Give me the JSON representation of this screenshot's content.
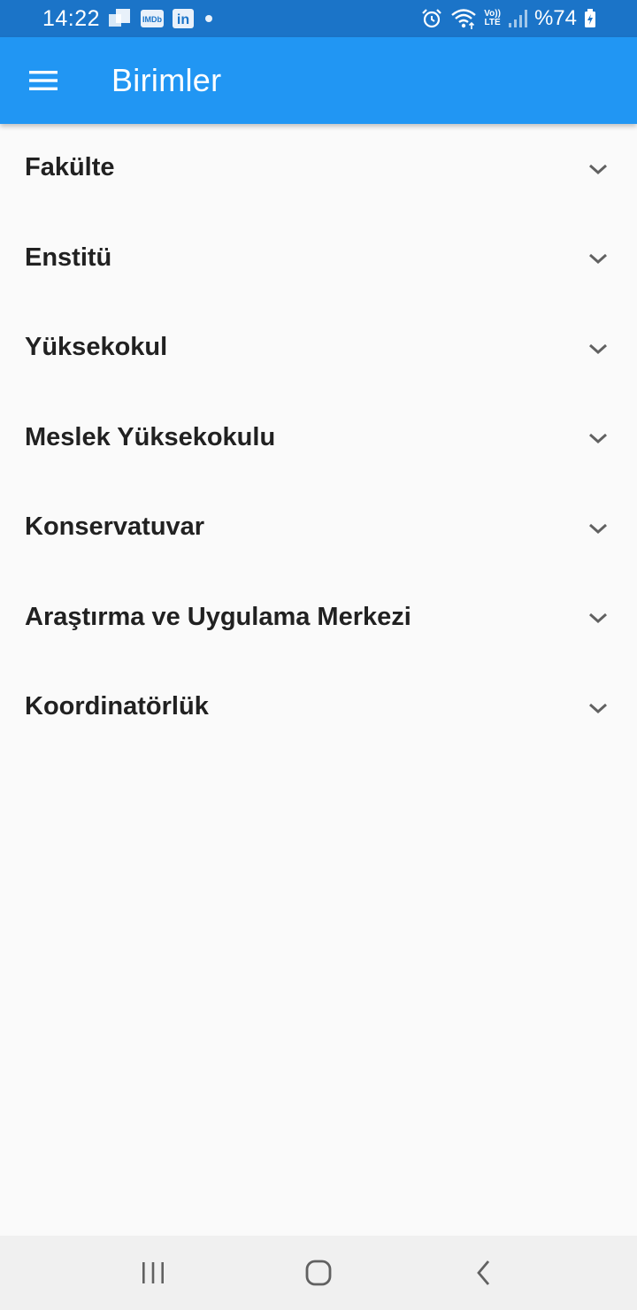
{
  "status_bar": {
    "time": "14:22",
    "notifications": [
      "gallery-icon",
      "imdb-icon",
      "linkedin-icon",
      "dot-icon"
    ],
    "imdb_text": "IMDb",
    "linkedin_text": "in",
    "volte_label": "Vo))",
    "lte_label": "LTE",
    "battery": "%74"
  },
  "app_bar": {
    "title": "Birimler",
    "background": "#2196f3"
  },
  "list": {
    "items": [
      {
        "label": "Fakülte"
      },
      {
        "label": "Enstitü"
      },
      {
        "label": "Yüksekokul"
      },
      {
        "label": "Meslek Yüksekokulu"
      },
      {
        "label": "Konservatuvar"
      },
      {
        "label": "Araştırma ve Uygulama Merkezi"
      },
      {
        "label": "Koordinatörlük"
      }
    ]
  },
  "nav_bar": {
    "buttons": [
      "recents-icon",
      "home-icon",
      "back-icon"
    ]
  }
}
